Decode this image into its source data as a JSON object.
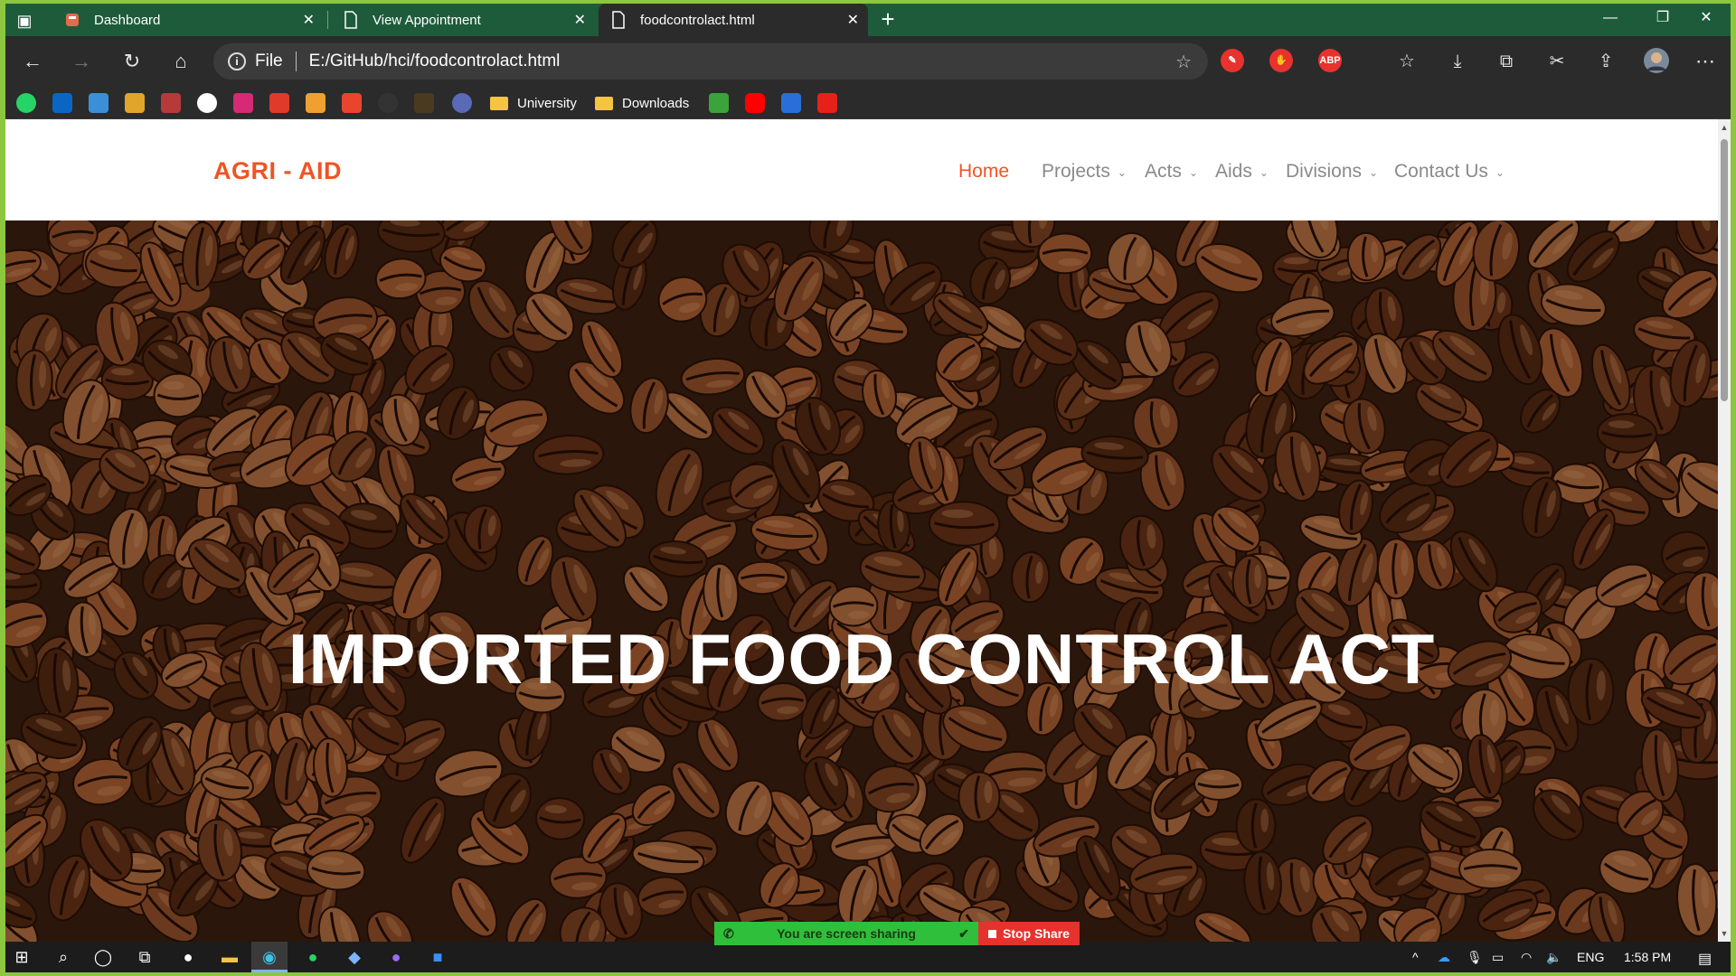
{
  "browser": {
    "tabs": [
      {
        "label": "Dashboard",
        "active": false
      },
      {
        "label": "View Appointment",
        "active": false
      },
      {
        "label": "foodcontrolact.html",
        "active": true
      }
    ],
    "address": {
      "scheme": "File",
      "url": "E:/GitHub/hci/foodcontrolact.html"
    },
    "bookmarks": [
      {
        "label": "University"
      },
      {
        "label": "Downloads"
      }
    ],
    "extensions": [
      "ABP"
    ]
  },
  "site": {
    "brand": "AGRI - AID",
    "nav": [
      {
        "label": "Home",
        "active": true
      },
      {
        "label": "Projects"
      },
      {
        "label": "Acts"
      },
      {
        "label": "Aids"
      },
      {
        "label": "Divisions"
      },
      {
        "label": "Contact Us"
      }
    ],
    "hero_title": "IMPORTED FOOD CONTROL ACT"
  },
  "screen_share": {
    "status": "You are screen sharing",
    "stop_label": "Stop Share"
  },
  "taskbar": {
    "language": "ENG",
    "time": "1:58 PM"
  },
  "colors": {
    "brand": "#ef5423",
    "nav_text": "#8a8a8a",
    "tab_strip": "#1e5b3b",
    "window_border": "#8dc63f"
  }
}
